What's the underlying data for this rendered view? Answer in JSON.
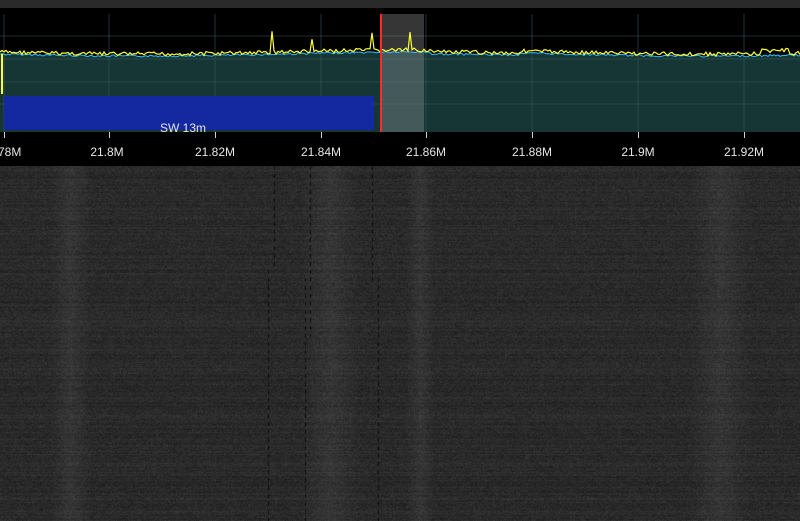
{
  "bandplan": {
    "label": "SW 13m",
    "color": "#1428a0"
  },
  "frequency_axis": {
    "labels": [
      "78M",
      "21.8M",
      "21.82M",
      "21.84M",
      "21.86M",
      "21.88M",
      "21.9M",
      "21.92M"
    ]
  },
  "colors": {
    "spectrum_fill": "#163636",
    "trace_peak": "#ffff33",
    "trace_avg": "#33bbff",
    "marker": "#ff2a2a",
    "passband": "#9a9a9a",
    "grid": "#3a5a5a"
  }
}
